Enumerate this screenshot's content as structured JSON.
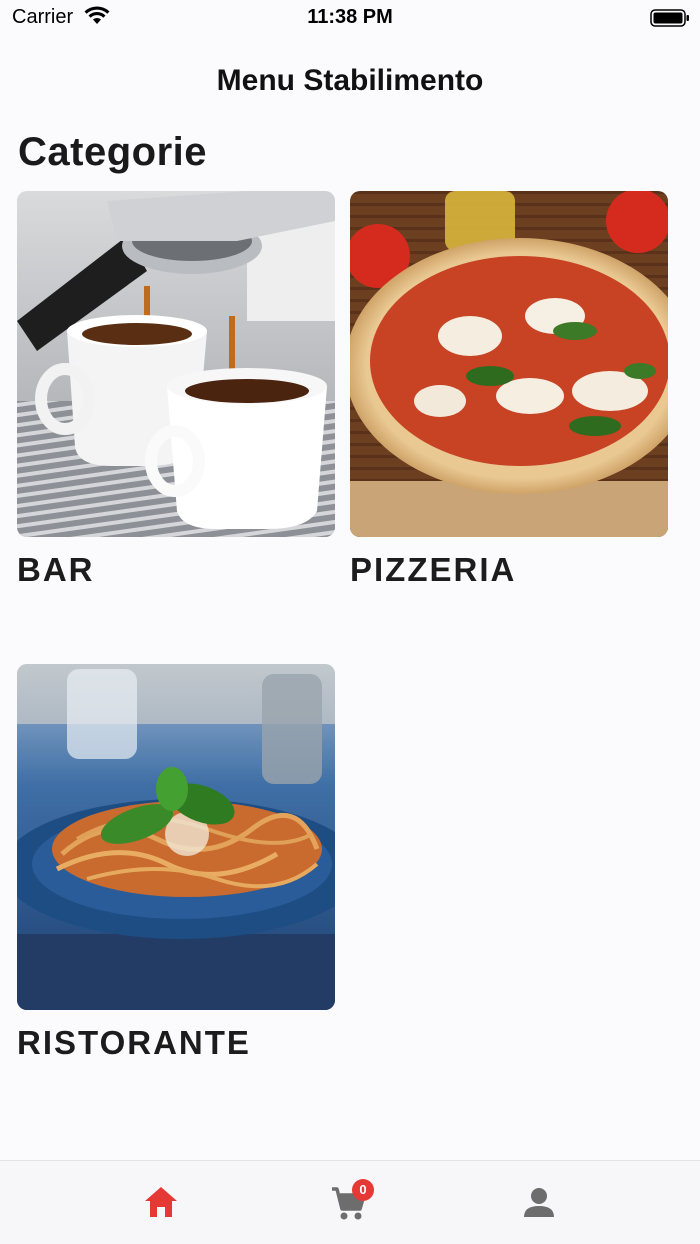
{
  "status_bar": {
    "carrier": "Carrier",
    "time": "11:38 PM"
  },
  "header": {
    "title": "Menu Stabilimento"
  },
  "section": {
    "title": "Categorie"
  },
  "categories": [
    {
      "label": "BAR",
      "image": "espresso-photo"
    },
    {
      "label": "PIZZERIA",
      "image": "pizza-photo"
    },
    {
      "label": "RISTORANTE",
      "image": "spaghetti-photo"
    }
  ],
  "tab_bar": {
    "items": [
      {
        "icon": "home-icon",
        "active": true
      },
      {
        "icon": "cart-icon",
        "badge": "0"
      },
      {
        "icon": "person-icon"
      }
    ],
    "active_color": "#e53935",
    "inactive_color": "#6d6d6d"
  }
}
